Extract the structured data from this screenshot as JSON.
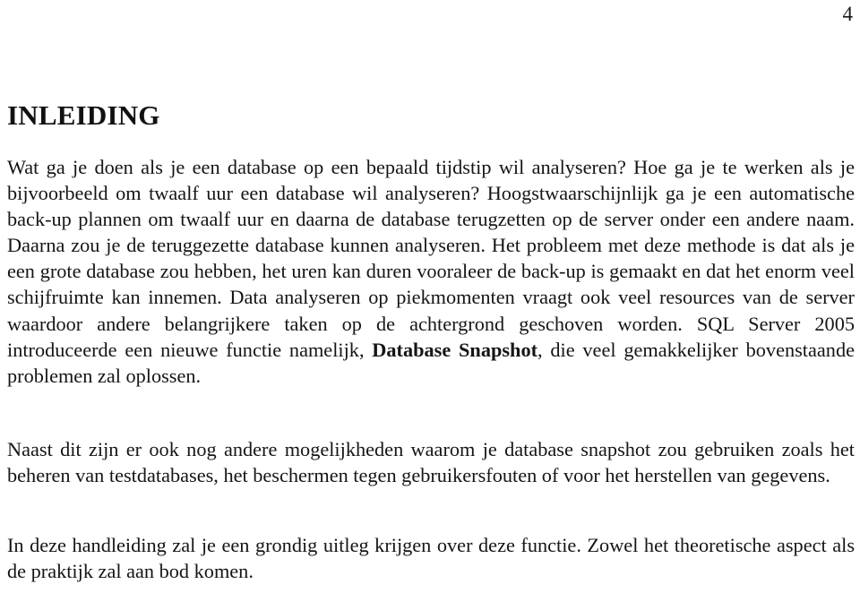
{
  "page": {
    "number": "4",
    "background_color": "#ffffff",
    "text_color": "#151515"
  },
  "heading": {
    "text": "INLEIDING"
  },
  "paragraphs": [
    {
      "id": "intro",
      "runs": [
        {
          "type": "text",
          "text": "Wat ga je doen als je een database op een bepaald tijdstip wil analyseren? Hoe ga je te werken als je bijvoorbeeld om twaalf uur een database wil analyseren? Hoogstwaarschijnlijk ga je een automatische back-up plannen om twaalf uur en daarna de database terugzetten op de server onder een andere naam. Daarna zou je de teruggezette database kunnen analyseren. "
        },
        {
          "type": "text",
          "text": "Het probleem met deze methode is dat als je een grote database zou hebben, het uren kan duren vooraleer de back-up is gemaakt en dat het enorm veel schijfruimte kan innemen. Data analyseren op piekmomenten vraagt ook veel resources van de server waardoor andere belangrijkere taken op de achtergrond geschoven worden. SQL Server 2005 introduceerde een nieuwe functie namelijk, "
        },
        {
          "type": "bold",
          "text": "Database Snapshot"
        },
        {
          "type": "text",
          "text": ", die veel gemakkelijker bovenstaande problemen zal oplossen."
        }
      ]
    },
    {
      "id": "other-uses",
      "runs": [
        {
          "type": "text",
          "text": "Naast dit zijn er ook nog andere mogelijkheden waarom je database snapshot zou gebruiken zoals het beheren van testdatabases, het beschermen tegen gebruikersfouten of voor het herstellen van gegevens."
        }
      ]
    },
    {
      "id": "scope",
      "runs": [
        {
          "type": "text",
          "text": "In deze handleiding zal je een grondig uitleg krijgen over deze functie. Zowel het theoretische aspect als de praktijk zal aan bod komen."
        }
      ]
    }
  ]
}
